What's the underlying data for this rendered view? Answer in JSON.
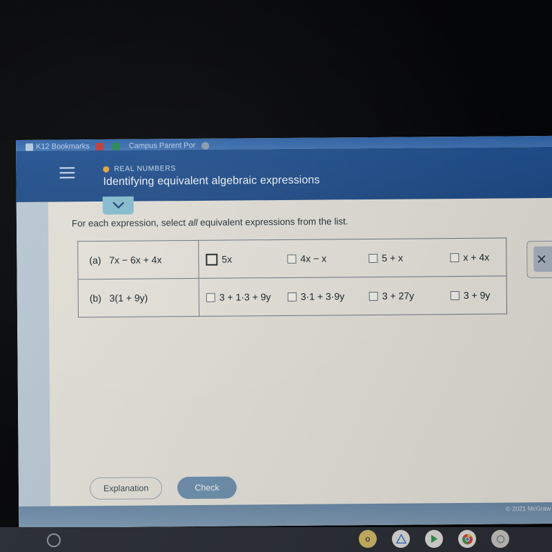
{
  "browser": {
    "bookmarks": [
      {
        "label": "K12 Bookmarks",
        "icon": "folder-icon"
      },
      {
        "label": "",
        "icon": "gmail-icon"
      },
      {
        "label": "",
        "icon": "messages-icon"
      },
      {
        "label": "Campus Parent Por",
        "icon": "link-icon"
      },
      {
        "label": "",
        "icon": "globe-icon"
      }
    ]
  },
  "header": {
    "menu_icon": "hamburger-icon",
    "kicker": "REAL NUMBERS",
    "kicker_dot_color": "#e8a33d",
    "title": "Identifying equivalent algebraic expressions",
    "background_color": "#1d4a86",
    "expand_icon": "chevron-down-icon"
  },
  "main": {
    "prompt_before": "For each expression, select ",
    "prompt_emphasis": "all",
    "prompt_after": " equivalent expressions from the list.",
    "rows": [
      {
        "label": "(a)",
        "expression": "7x − 6x + 4x",
        "options": [
          {
            "text": "5x",
            "checked": false,
            "focused": true
          },
          {
            "text": "4x − x",
            "checked": false,
            "focused": false
          },
          {
            "text": "5 + x",
            "checked": false,
            "focused": false
          },
          {
            "text": "x + 4x",
            "checked": false,
            "focused": false
          }
        ]
      },
      {
        "label": "(b)",
        "expression": "3(1 + 9y)",
        "options": [
          {
            "text": "3 + 1·3 + 9y",
            "checked": false,
            "focused": false
          },
          {
            "text": "3·1 + 3·9y",
            "checked": false,
            "focused": false
          },
          {
            "text": "3 + 27y",
            "checked": false,
            "focused": false
          },
          {
            "text": "3 + 9y",
            "checked": false,
            "focused": false
          }
        ]
      }
    ]
  },
  "side_panel": {
    "close_icon": "close-x-icon"
  },
  "footer": {
    "explanation_label": "Explanation",
    "check_label": "Check",
    "check_color": "#6f90ad",
    "copyright": "© 2021 McGraw"
  },
  "taskbar": {
    "launcher_icon": "launcher-circle-icon",
    "items": [
      {
        "icon": "assistant-icon"
      },
      {
        "icon": "drive-icon"
      },
      {
        "icon": "play-store-icon"
      },
      {
        "icon": "chrome-icon"
      },
      {
        "icon": "app-icon"
      }
    ]
  }
}
